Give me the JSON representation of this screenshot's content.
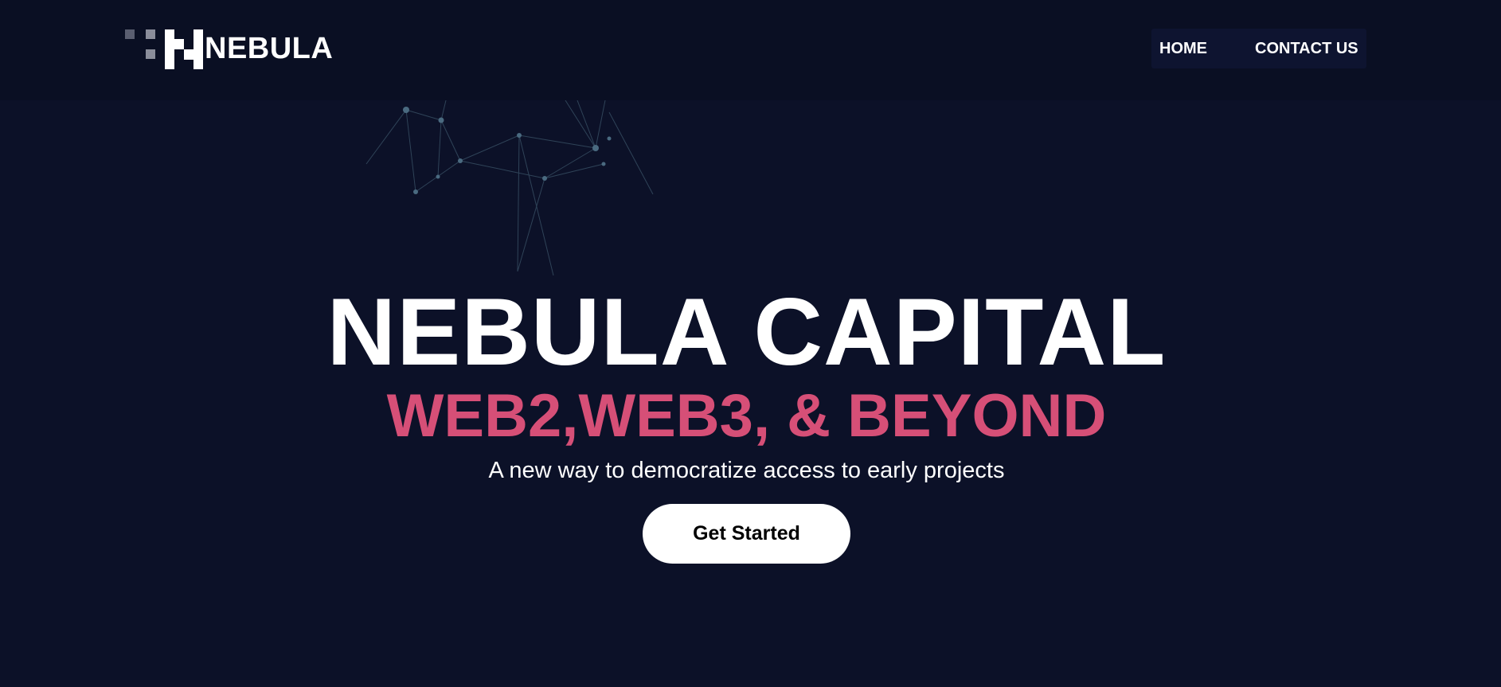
{
  "brand": {
    "name": "NEBULA"
  },
  "nav": {
    "items": [
      {
        "label": "HOME"
      },
      {
        "label": "CONTACT US"
      }
    ]
  },
  "hero": {
    "title": "NEBULA CAPITAL",
    "subtitle": "WEB2,WEB3, & BEYOND",
    "tagline": "A new way to democratize access to early projects",
    "cta_label": "Get Started"
  },
  "colors": {
    "background": "#0c1128",
    "navbar": "#0a0f23",
    "accent": "#d64f77",
    "text": "#ffffff"
  }
}
